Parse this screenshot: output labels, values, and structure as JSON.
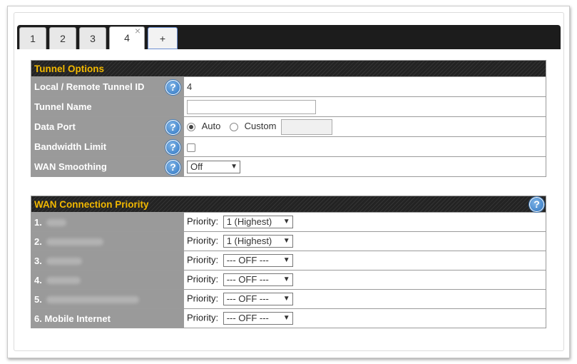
{
  "tabs": [
    {
      "label": "1"
    },
    {
      "label": "2"
    },
    {
      "label": "3"
    },
    {
      "label": "4"
    },
    {
      "label": "+"
    }
  ],
  "tab_close_glyph": "×",
  "tunnel_options": {
    "header": "Tunnel Options",
    "rows": {
      "tunnel_id": {
        "label": "Local / Remote Tunnel ID",
        "value": "4"
      },
      "tunnel_name": {
        "label": "Tunnel Name",
        "value": ""
      },
      "data_port": {
        "label": "Data Port",
        "auto": "Auto",
        "custom": "Custom",
        "selected": "Auto"
      },
      "bandwidth_limit": {
        "label": "Bandwidth Limit",
        "checked": false
      },
      "wan_smoothing": {
        "label": "WAN Smoothing",
        "value": "Off"
      }
    },
    "help_glyph": "?"
  },
  "wan_priority": {
    "header": "WAN Connection Priority",
    "priority_label": "Priority:",
    "rows": [
      {
        "label": "1.",
        "priority": "1 (Highest)"
      },
      {
        "label": "2.",
        "priority": "1 (Highest)"
      },
      {
        "label": "3.",
        "priority": "--- OFF ---"
      },
      {
        "label": "4.",
        "priority": "--- OFF ---"
      },
      {
        "label": "5.",
        "priority": "--- OFF ---"
      },
      {
        "label": "6. Mobile Internet",
        "priority": "--- OFF ---"
      }
    ]
  },
  "colors": {
    "header_text": "#f2b800",
    "label_bg": "#9a9a9a",
    "tab_bar_bg": "#1c1c1c",
    "help_icon": "#2f76c3"
  }
}
